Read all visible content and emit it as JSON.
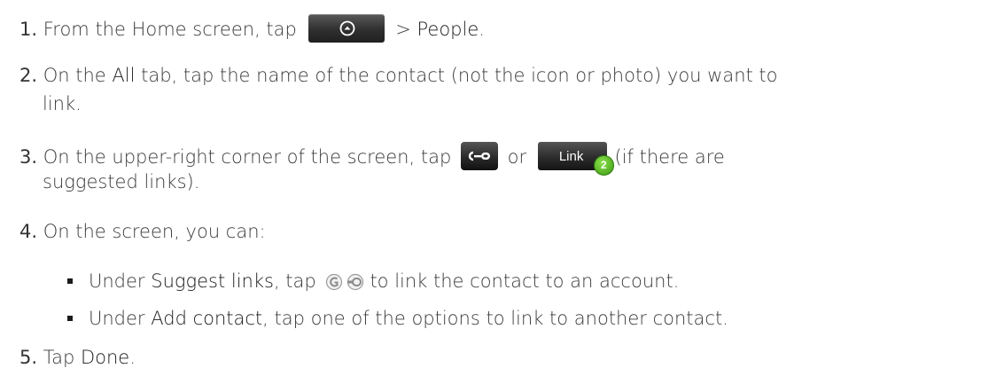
{
  "steps": [
    {
      "num": "1.",
      "pre": "From the Home screen, tap",
      "home_button_icon": "home-up-arrow-icon",
      "post": " > ",
      "target": "People",
      "end": "."
    },
    {
      "num": "2.",
      "pre": "On the ",
      "tab": "All",
      "post_line1": " tab, tap the name of the contact (not the icon or photo) you want to",
      "post_line2": "link."
    },
    {
      "num": "3.",
      "pre": "On the upper-right corner of the screen, tap",
      "or": "or",
      "link_button_label": "Link",
      "link_badge": "2",
      "post_line1": "(if there are",
      "post_line2": "suggested links)."
    },
    {
      "num": "4.",
      "text": "On the screen, you can:",
      "subitems": [
        {
          "pre": "Under ",
          "label": "Suggest links",
          "mid": ", tap",
          "post": "to link the contact to an account."
        },
        {
          "pre": "Under ",
          "label": "Add contact",
          "post": ", tap one of the options to link to another contact."
        }
      ]
    },
    {
      "num": "5.",
      "pre": "Tap ",
      "label": "Done",
      "end": "."
    }
  ],
  "colors": {
    "text": "#3a3a3a",
    "highlight": "#1a1a1a",
    "button_dark": "#2c2c2c",
    "badge_green": "#3b9a12"
  }
}
